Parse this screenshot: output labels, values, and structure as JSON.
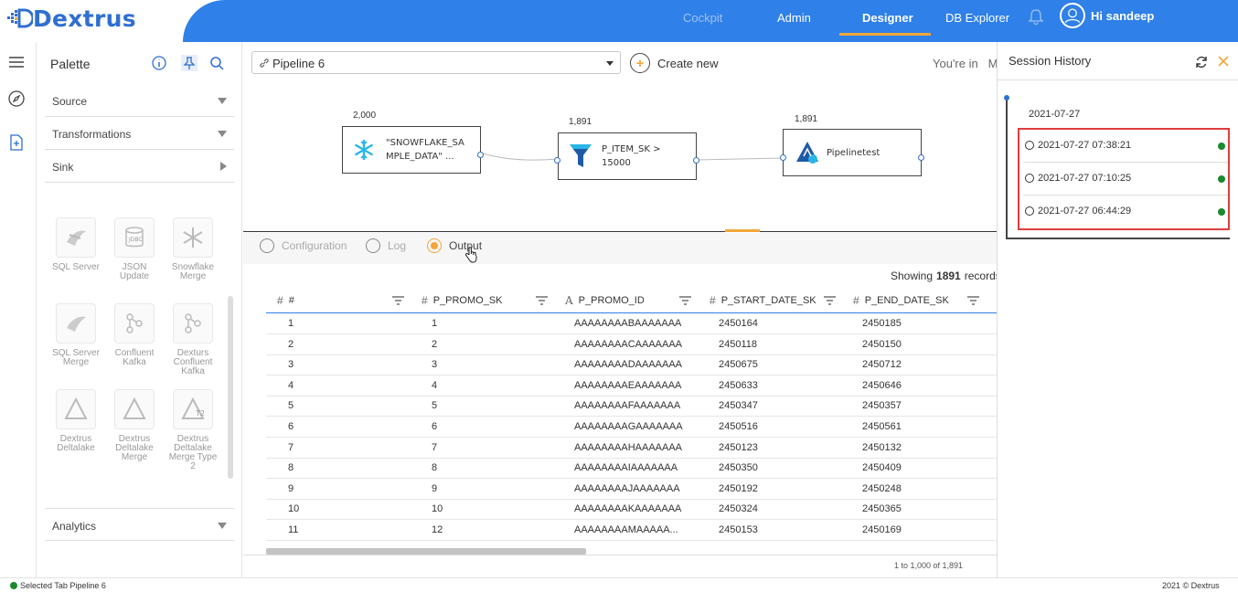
{
  "app": {
    "name": "Dextrus"
  },
  "nav": {
    "items": [
      {
        "label": "Cockpit",
        "state": "muted"
      },
      {
        "label": "Admin",
        "state": "normal"
      },
      {
        "label": "Designer",
        "state": "active"
      },
      {
        "label": "DB Explorer",
        "state": "normal"
      }
    ]
  },
  "user": {
    "greeting": "Hi sandeep"
  },
  "palette": {
    "title": "Palette",
    "sections": [
      {
        "label": "Source"
      },
      {
        "label": "Transformations"
      },
      {
        "label": "Sink"
      }
    ],
    "tiles": [
      {
        "label": "SQL Server"
      },
      {
        "label": "JSON Update"
      },
      {
        "label": "Snowflake Merge"
      },
      {
        "label": "SQL Server Merge"
      },
      {
        "label": "Confluent Kafka"
      },
      {
        "label": "Dexturs Confluent Kafka"
      },
      {
        "label": "Dextrus Deltalake"
      },
      {
        "label": "Dextrus Deltalake Merge"
      },
      {
        "label": "Dextrus Deltalake Merge Type 2"
      }
    ],
    "analytics": "Analytics"
  },
  "toolbar": {
    "pipeline": "Pipeline 6",
    "create_new": "Create new",
    "youre_in": "You're in",
    "youre_in_cut": "M"
  },
  "pipeline_nodes": [
    {
      "count": "2,000",
      "label_l1": "\"SNOWFLAKE_SA",
      "label_l2": "MPLE_DATA\" ..."
    },
    {
      "count": "1,891",
      "label_l1": "P_ITEM_SK >",
      "label_l2": "15000"
    },
    {
      "count": "1,891",
      "label_l1": "Pipelinetest",
      "label_l2": ""
    }
  ],
  "tabs": [
    {
      "label": "Configuration"
    },
    {
      "label": "Log"
    },
    {
      "label": "Output"
    }
  ],
  "grid": {
    "showing_label": "Showing",
    "showing_count": "1891",
    "showing_suffix": "records",
    "columns": [
      {
        "type": "#",
        "name": "#"
      },
      {
        "type": "#",
        "name": "P_PROMO_SK"
      },
      {
        "type": "A",
        "name": "P_PROMO_ID"
      },
      {
        "type": "#",
        "name": "P_START_DATE_SK"
      },
      {
        "type": "#",
        "name": "P_END_DATE_SK"
      }
    ],
    "rows": [
      [
        "1",
        "1",
        "AAAAAAAABAAAAAAA",
        "2450164",
        "2450185"
      ],
      [
        "2",
        "2",
        "AAAAAAAACAAAAAAA",
        "2450118",
        "2450150"
      ],
      [
        "3",
        "3",
        "AAAAAAAADAAAAAAA",
        "2450675",
        "2450712"
      ],
      [
        "4",
        "4",
        "AAAAAAAAEAAAAAAA",
        "2450633",
        "2450646"
      ],
      [
        "5",
        "5",
        "AAAAAAAAFAAAAAAA",
        "2450347",
        "2450357"
      ],
      [
        "6",
        "6",
        "AAAAAAAAGAAAAAAA",
        "2450516",
        "2450561"
      ],
      [
        "7",
        "7",
        "AAAAAAAAHAAAAAAA",
        "2450123",
        "2450132"
      ],
      [
        "8",
        "8",
        "AAAAAAAAIAAAAAAA",
        "2450350",
        "2450409"
      ],
      [
        "9",
        "9",
        "AAAAAAAAJAAAAAAA",
        "2450192",
        "2450248"
      ],
      [
        "10",
        "10",
        "AAAAAAAAKAAAAAAA",
        "2450324",
        "2450365"
      ],
      [
        "11",
        "12",
        "AAAAAAAAMAAAAA...",
        "2450153",
        "2450169"
      ]
    ],
    "pagination": "1 to 1,000 of 1,891"
  },
  "session": {
    "title": "Session History",
    "date": "2021-07-27",
    "items": [
      {
        "time": "2021-07-27 07:38:21",
        "status_color": "#1a8a2e"
      },
      {
        "time": "2021-07-27 07:10:25",
        "status_color": "#1a8a2e"
      },
      {
        "time": "2021-07-27 06:44:29",
        "status_color": "#1a8a2e"
      }
    ]
  },
  "footer": {
    "status": "Selected Tab Pipeline 6",
    "copyright": "2021 © Dextrus"
  },
  "colors": {
    "accent": "#2f80e8",
    "highlight": "#f3a73b",
    "success": "#1a8a2e",
    "alert": "#e03c3c"
  }
}
